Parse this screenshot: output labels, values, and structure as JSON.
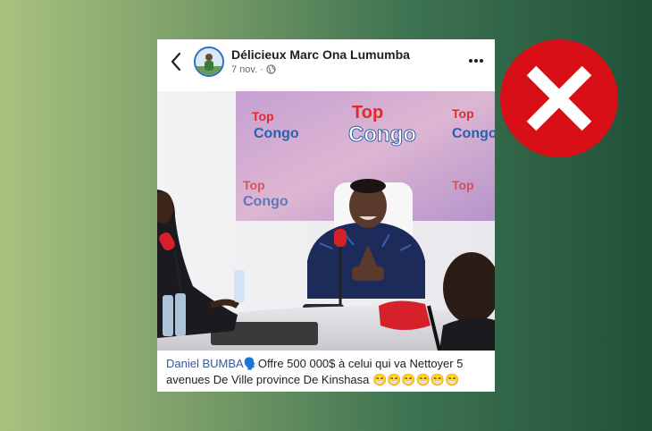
{
  "post": {
    "author": "Délicieux Marc Ona Lumumba",
    "date": "7 nov.",
    "separator": "·",
    "caption_mention": "Daniel BUMBA",
    "caption_speaker": "🗣️",
    "caption_text": "Offre 500 000$ à celui qui va Nettoyer 5 avenues De Ville province De Kinshasa",
    "caption_emojis": "😁😁😁😁😁😁"
  },
  "photo": {
    "logo_word1": "Top",
    "logo_word2": "Congo"
  },
  "icons": {
    "back": "chevron-left-icon",
    "globe": "globe-icon",
    "more": "more-dots-icon",
    "verdict": "red-x-icon"
  },
  "colors": {
    "verdict_red": "#d80f17",
    "mention_blue": "#385898",
    "logo_red": "#e02a2a",
    "logo_blue": "#2b5fb0"
  }
}
